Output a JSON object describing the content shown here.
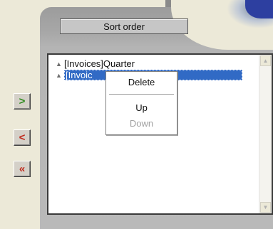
{
  "panel": {
    "title": "Sort order"
  },
  "sort_list": {
    "items": [
      {
        "label": "[Invoices]Quarter",
        "selected": false
      },
      {
        "label": "[Invoic",
        "selected": true
      }
    ]
  },
  "nav_buttons": [
    {
      "icon": "arrow-right-icon",
      "glyph": ">",
      "color": "#2e8b1e"
    },
    {
      "icon": "arrow-left-icon",
      "glyph": "<",
      "color": "#c0281a"
    },
    {
      "icon": "double-arrow-left-icon",
      "glyph": "«",
      "color": "#c0281a"
    }
  ],
  "context_menu": {
    "delete": "Delete",
    "up": "Up",
    "down": "Down"
  },
  "glyphs": {
    "up_arrow": "▲",
    "down_arrow": "▼"
  },
  "colors": {
    "selection": "#316ac5",
    "disabled_text": "#a0a0a0"
  }
}
